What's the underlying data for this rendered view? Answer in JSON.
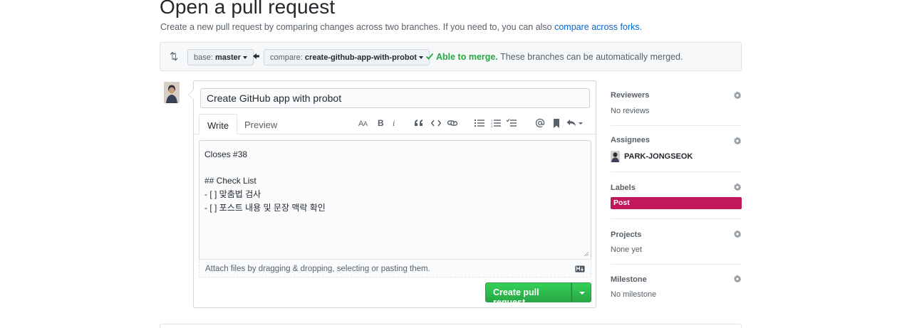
{
  "page": {
    "title": "Open a pull request",
    "subtitle_prefix": "Create a new pull request by comparing changes across two branches. If you need to, you can also ",
    "subtitle_link": "compare across forks",
    "subtitle_suffix": "."
  },
  "range": {
    "base_prefix": "base: ",
    "base_branch": "master",
    "compare_prefix": "compare: ",
    "compare_branch": "create-github-app-with-probot",
    "merge_ok": "Able to merge.",
    "merge_text": " These branches can be automatically merged."
  },
  "composer": {
    "title_value": "Create GitHub app with probot",
    "tabs": {
      "write": "Write",
      "preview": "Preview"
    },
    "body": "Closes #38\n\n## Check List\n- [ ] 맞춤법 검사\n- [ ] 포스트 내용 및 문장 맥락 확인",
    "attach_hint": "Attach files by dragging & dropping, selecting or pasting them.",
    "submit_label": "Create pull request"
  },
  "toolbar_icons": [
    "header-text-icon",
    "bold-icon",
    "italic-icon",
    "quote-icon",
    "code-icon",
    "link-icon",
    "bulleted-list-icon",
    "numbered-list-icon",
    "task-list-icon",
    "mention-icon",
    "bookmark-icon",
    "reply-icon"
  ],
  "sidebar": {
    "reviewers": {
      "heading": "Reviewers",
      "value": "No reviews"
    },
    "assignees": {
      "heading": "Assignees",
      "user": "PARK-JONGSEOK"
    },
    "labels": {
      "heading": "Labels",
      "label": "Post",
      "label_color": "#c2185b"
    },
    "projects": {
      "heading": "Projects",
      "value": "None yet"
    },
    "milestone": {
      "heading": "Milestone",
      "value": "No milestone"
    }
  },
  "colors": {
    "link": "#0366d6",
    "success": "#28a745",
    "label": "#c2185b"
  }
}
